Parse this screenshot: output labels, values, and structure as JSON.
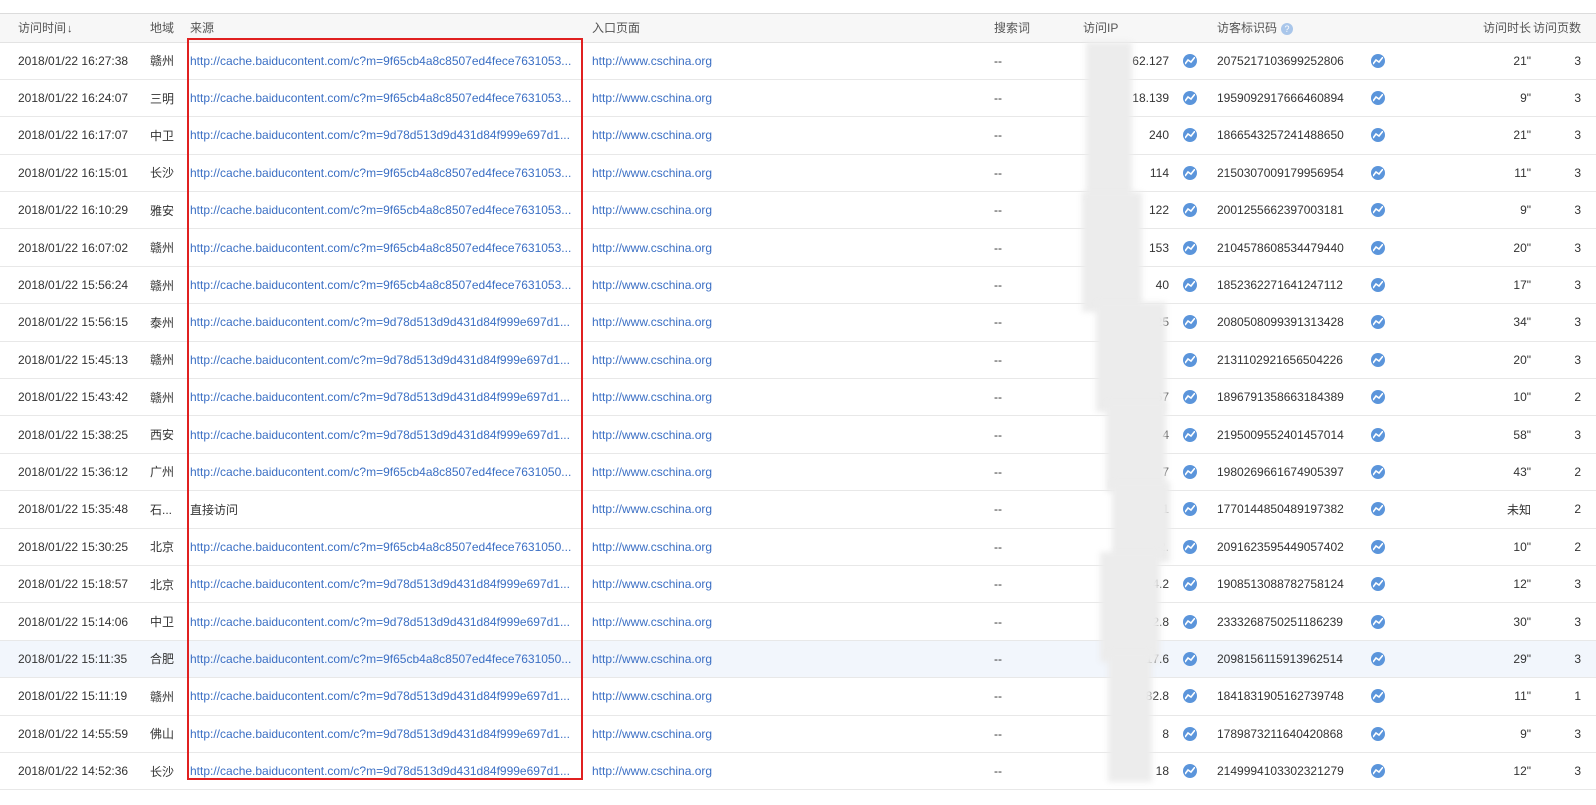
{
  "headers": {
    "time": "访问时间",
    "region": "地域",
    "source": "来源",
    "entry": "入口页面",
    "keyword": "搜索词",
    "ip": "访问IP",
    "visitor_id": "访客标识码",
    "duration": "访问时长",
    "pages": "访问页数"
  },
  "icons": {
    "sort": "sort-down-arrow-icon",
    "help": "question-mark-icon",
    "trend": "trend-chart-icon"
  },
  "colors": {
    "link": "#3b6fc4",
    "highlight_box": "#e02020",
    "trend_icon": "#5b95db"
  },
  "rows": [
    {
      "time": "2018/01/22 16:27:38",
      "region": "赣州",
      "source": "http://cache.baiducontent.com/c?m=9f65cb4a8c8507ed4fece7631053...",
      "entry": "http://www.cschina.org",
      "keyword": "--",
      "ip": "62.127",
      "visitor_id": "2075217103699252806",
      "duration": "21\"",
      "pages": "3"
    },
    {
      "time": "2018/01/22 16:24:07",
      "region": "三明",
      "source": "http://cache.baiducontent.com/c?m=9f65cb4a8c8507ed4fece7631053...",
      "entry": "http://www.cschina.org",
      "keyword": "--",
      "ip": "18.139",
      "visitor_id": "1959092917666460894",
      "duration": "9\"",
      "pages": "3"
    },
    {
      "time": "2018/01/22 16:17:07",
      "region": "中卫",
      "source": "http://cache.baiducontent.com/c?m=9d78d513d9d431d84f999e697d1...",
      "entry": "http://www.cschina.org",
      "keyword": "--",
      "ip": "240",
      "visitor_id": "1866543257241488650",
      "duration": "21\"",
      "pages": "3"
    },
    {
      "time": "2018/01/22 16:15:01",
      "region": "长沙",
      "source": "http://cache.baiducontent.com/c?m=9f65cb4a8c8507ed4fece7631053...",
      "entry": "http://www.cschina.org",
      "keyword": "--",
      "ip": "114",
      "visitor_id": "2150307009179956954",
      "duration": "11\"",
      "pages": "3"
    },
    {
      "time": "2018/01/22 16:10:29",
      "region": "雅安",
      "source": "http://cache.baiducontent.com/c?m=9f65cb4a8c8507ed4fece7631053...",
      "entry": "http://www.cschina.org",
      "keyword": "--",
      "ip": "122",
      "visitor_id": "2001255662397003181",
      "duration": "9\"",
      "pages": "3"
    },
    {
      "time": "2018/01/22 16:07:02",
      "region": "赣州",
      "source": "http://cache.baiducontent.com/c?m=9f65cb4a8c8507ed4fece7631053...",
      "entry": "http://www.cschina.org",
      "keyword": "--",
      "ip": "153",
      "visitor_id": "2104578608534479440",
      "duration": "20\"",
      "pages": "3"
    },
    {
      "time": "2018/01/22 15:56:24",
      "region": "赣州",
      "source": "http://cache.baiducontent.com/c?m=9f65cb4a8c8507ed4fece7631053...",
      "entry": "http://www.cschina.org",
      "keyword": "--",
      "ip": "40",
      "visitor_id": "1852362271641247112",
      "duration": "17\"",
      "pages": "3"
    },
    {
      "time": "2018/01/22 15:56:15",
      "region": "泰州",
      "source": "http://cache.baiducontent.com/c?m=9d78d513d9d431d84f999e697d1...",
      "entry": "http://www.cschina.org",
      "keyword": "--",
      "ip": "25",
      "visitor_id": "2080508099391313428",
      "duration": "34\"",
      "pages": "3"
    },
    {
      "time": "2018/01/22 15:45:13",
      "region": "赣州",
      "source": "http://cache.baiducontent.com/c?m=9d78d513d9d431d84f999e697d1...",
      "entry": "http://www.cschina.org",
      "keyword": "--",
      "ip": "",
      "visitor_id": "2131102921656504226",
      "duration": "20\"",
      "pages": "3"
    },
    {
      "time": "2018/01/22 15:43:42",
      "region": "赣州",
      "source": "http://cache.baiducontent.com/c?m=9d78d513d9d431d84f999e697d1...",
      "entry": "http://www.cschina.org",
      "keyword": "--",
      "ip": "67",
      "visitor_id": "1896791358663184389",
      "duration": "10\"",
      "pages": "2"
    },
    {
      "time": "2018/01/22 15:38:25",
      "region": "西安",
      "source": "http://cache.baiducontent.com/c?m=9d78d513d9d431d84f999e697d1...",
      "entry": "http://www.cschina.org",
      "keyword": "--",
      "ip": "4",
      "visitor_id": "2195009552401457014",
      "duration": "58\"",
      "pages": "3"
    },
    {
      "time": "2018/01/22 15:36:12",
      "region": "广州",
      "source": "http://cache.baiducontent.com/c?m=9f65cb4a8c8507ed4fece7631050...",
      "entry": "http://www.cschina.org",
      "keyword": "--",
      "ip": "7",
      "visitor_id": "1980269661674905397",
      "duration": "43\"",
      "pages": "2"
    },
    {
      "time": "2018/01/22 15:35:48",
      "region": "石...",
      "source": "直接访问",
      "source_is_link": false,
      "entry": "http://www.cschina.org",
      "keyword": "--",
      "ip": "11",
      "visitor_id": "1770144850489197382",
      "duration": "未知",
      "pages": "2"
    },
    {
      "time": "2018/01/22 15:30:25",
      "region": "北京",
      "source": "http://cache.baiducontent.com/c?m=9f65cb4a8c8507ed4fece7631050...",
      "entry": "http://www.cschina.org",
      "keyword": "--",
      "ip": "52.",
      "visitor_id": "2091623595449057402",
      "duration": "10\"",
      "pages": "2"
    },
    {
      "time": "2018/01/22 15:18:57",
      "region": "北京",
      "source": "http://cache.baiducontent.com/c?m=9d78d513d9d431d84f999e697d1...",
      "entry": "http://www.cschina.org",
      "keyword": "--",
      "ip": "54.2",
      "visitor_id": "1908513088782758124",
      "duration": "12\"",
      "pages": "3"
    },
    {
      "time": "2018/01/22 15:14:06",
      "region": "中卫",
      "source": "http://cache.baiducontent.com/c?m=9d78d513d9d431d84f999e697d1...",
      "entry": "http://www.cschina.org",
      "keyword": "--",
      "ip": "52.8",
      "visitor_id": "2333268750251186239",
      "duration": "30\"",
      "pages": "3"
    },
    {
      "time": "2018/01/22 15:11:35",
      "region": "合肥",
      "source": "http://cache.baiducontent.com/c?m=9f65cb4a8c8507ed4fece7631050...",
      "entry": "http://www.cschina.org",
      "keyword": "--",
      "ip": "117.6",
      "visitor_id": "2098156115913962514",
      "duration": "29\"",
      "pages": "3",
      "highlight": true
    },
    {
      "time": "2018/01/22 15:11:19",
      "region": "赣州",
      "source": "http://cache.baiducontent.com/c?m=9d78d513d9d431d84f999e697d1...",
      "entry": "http://www.cschina.org",
      "keyword": "--",
      "ip": "182.8",
      "visitor_id": "1841831905162739748",
      "duration": "11\"",
      "pages": "1"
    },
    {
      "time": "2018/01/22 14:55:59",
      "region": "佛山",
      "source": "http://cache.baiducontent.com/c?m=9d78d513d9d431d84f999e697d1...",
      "entry": "http://www.cschina.org",
      "keyword": "--",
      "ip": "8",
      "visitor_id": "1789873211640420868",
      "duration": "9\"",
      "pages": "3"
    },
    {
      "time": "2018/01/22 14:52:36",
      "region": "长沙",
      "source": "http://cache.baiducontent.com/c?m=9d78d513d9d431d84f999e697d1...",
      "entry": "http://www.cschina.org",
      "keyword": "--",
      "ip": "18",
      "visitor_id": "2149994103302321279",
      "duration": "12\"",
      "pages": "3"
    }
  ]
}
